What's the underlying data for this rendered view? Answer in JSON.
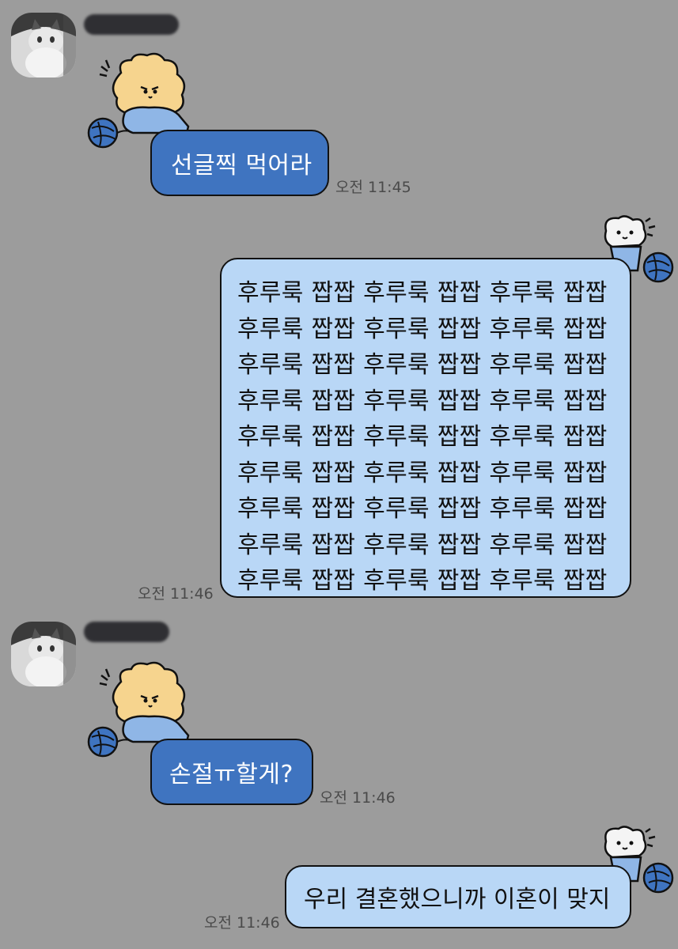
{
  "colors": {
    "background": "#9c9c9c",
    "incoming_bubble": "#3f74c0",
    "outgoing_bubble": "#b9d7f6",
    "name_redaction": "#2f2f33"
  },
  "messages": [
    {
      "direction": "incoming",
      "sender_name_redacted": true,
      "sticker": "bear-knitting-sticker",
      "text": "선글찍 먹어라",
      "time": "오전 11:45"
    },
    {
      "direction": "outgoing",
      "sticker": "white-bear-knitting-sticker",
      "lines": [
        "후루룩 짭짭 후루룩 짭짭 후루룩 짭짭",
        "후루룩 짭짭 후루룩 짭짭 후루룩 짭짭",
        "후루룩 짭짭 후루룩 짭짭 후루룩 짭짭",
        "후루룩 짭짭 후루룩 짭짭 후루룩 짭짭",
        "후루룩 짭짭 후루룩 짭짭 후루룩 짭짭",
        "후루룩 짭짭 후루룩 짭짭 후루룩 짭짭",
        "후루룩 짭짭 후루룩 짭짭 후루룩 짭짭",
        "후루룩 짭짭 후루룩 짭짭 후루룩 짭짭",
        "후루룩 짭짭 후루룩 짭짭 후루룩 짭짭"
      ],
      "time": "오전 11:46"
    },
    {
      "direction": "incoming",
      "sender_name_redacted": true,
      "sticker": "bear-knitting-sticker",
      "text": "손절ㅠ할게?",
      "time": "오전 11:46"
    },
    {
      "direction": "outgoing",
      "sticker": "white-bear-knitting-sticker",
      "text": "우리 결혼했으니까 이혼이 맞지",
      "time": "오전 11:46"
    }
  ]
}
